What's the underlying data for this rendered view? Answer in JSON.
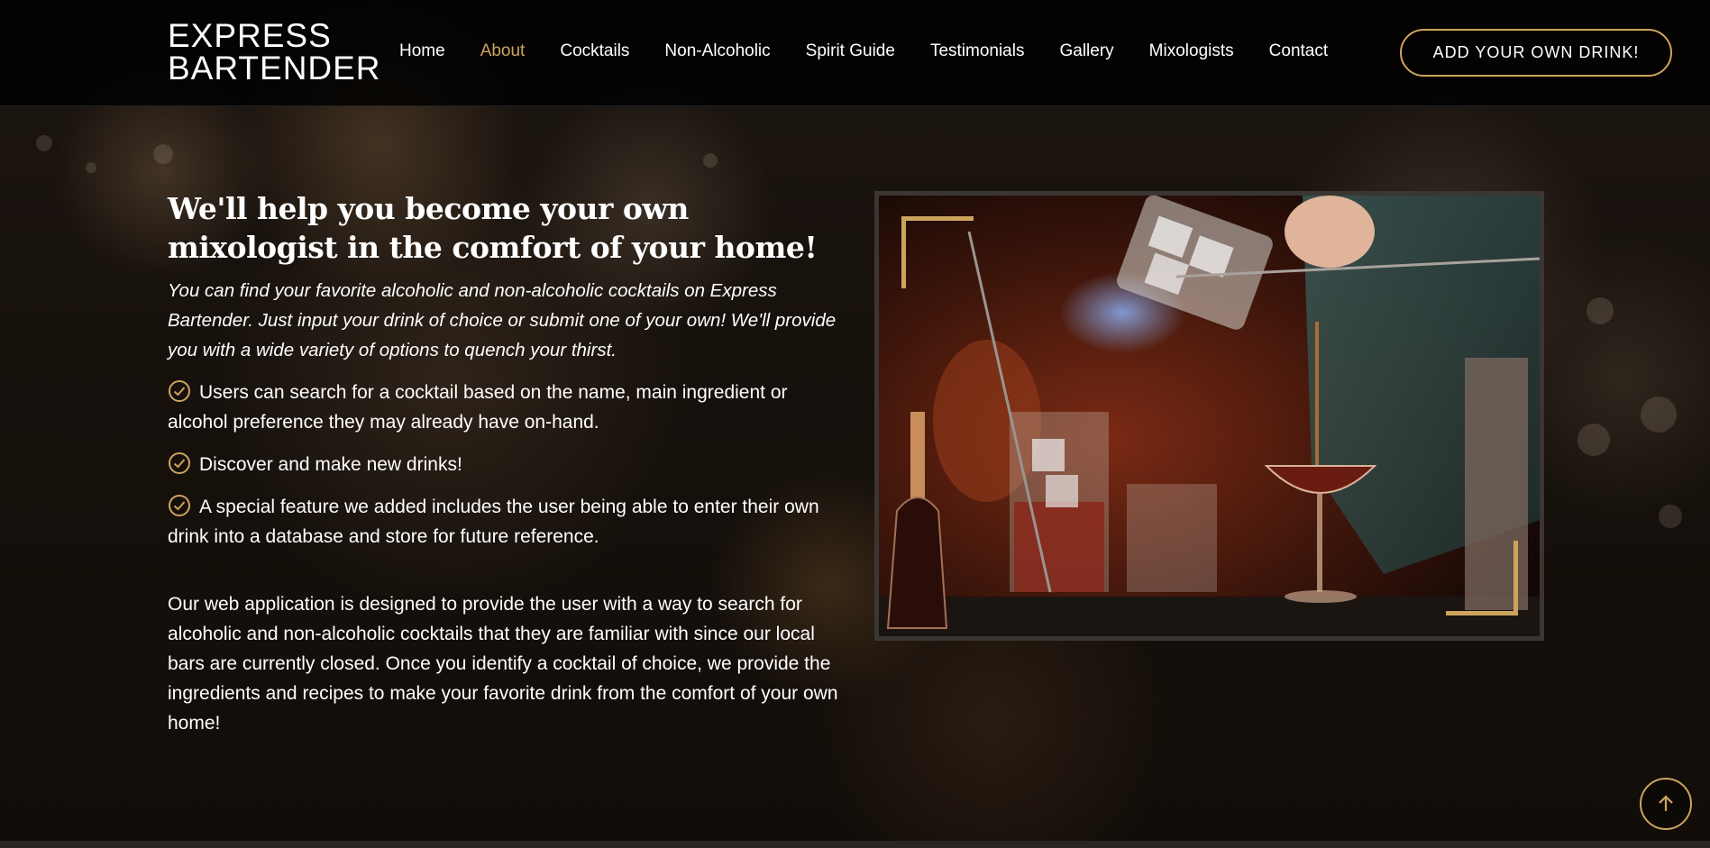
{
  "brand": {
    "line1": "EXPRESS",
    "line2": "BARTENDER"
  },
  "nav": {
    "items": [
      {
        "label": "Home",
        "active": false
      },
      {
        "label": "About",
        "active": true
      },
      {
        "label": "Cocktails",
        "active": false
      },
      {
        "label": "Non-Alcoholic",
        "active": false
      },
      {
        "label": "Spirit Guide",
        "active": false
      },
      {
        "label": "Testimonials",
        "active": false
      },
      {
        "label": "Gallery",
        "active": false
      },
      {
        "label": "Mixologists",
        "active": false
      },
      {
        "label": "Contact",
        "active": false
      }
    ],
    "cta_label": "ADD YOUR OWN DRINK!"
  },
  "about": {
    "heading": "We'll help you become your own mixologist in the comfort of your home!",
    "lead": "You can find your favorite alcoholic and non-alcoholic cocktails on Express Bartender. Just input your drink of choice or submit one of your own! We'll provide you with a wide variety of options to quench your thirst.",
    "features": [
      "Users can search for a cocktail based on the name, main ingredient or alcohol preference they may already have on-hand.",
      "Discover and make new drinks!",
      "A special feature we added includes the user being able to enter their own drink into a database and store for future reference."
    ],
    "paragraph": "Our web application is designed to provide the user with a way to search for alcoholic and non-alcoholic cocktails that they are familiar with since our local bars are currently closed. Once you identify a cocktail of choice, we provide the ingredients and recipes to make your favorite drink from the comfort of your own home!"
  },
  "icons": {
    "check": "check-circle-icon",
    "back_to_top": "arrow-up-icon"
  },
  "colors": {
    "accent": "#cda45e",
    "header_bg": "#000000",
    "page_bg": "#120d09"
  }
}
